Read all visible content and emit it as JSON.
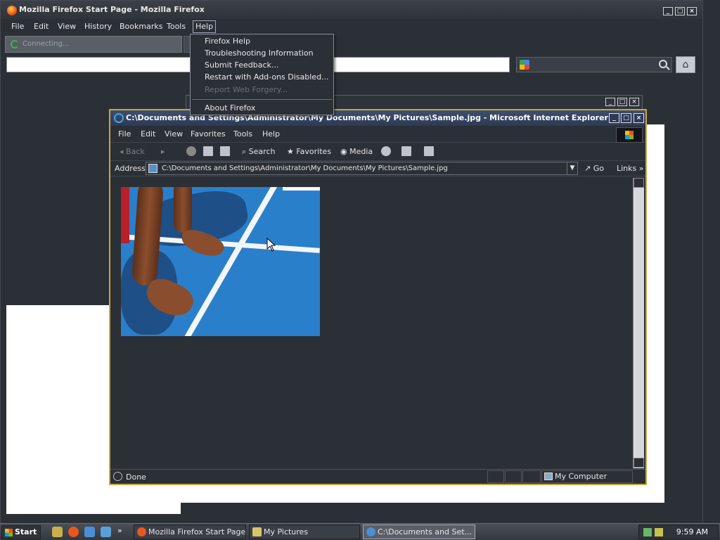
{
  "firefox": {
    "title": "Mozilla Firefox Start Page - Mozilla Firefox",
    "menu": [
      "File",
      "Edit",
      "View",
      "History",
      "Bookmarks",
      "Tools",
      "Help"
    ],
    "tab_label": "Connecting...",
    "help_menu": {
      "items": [
        "Firefox Help",
        "Troubleshooting Information",
        "Submit Feedback...",
        "Restart with Add-ons Disabled..."
      ],
      "disabled_item": "Report Web Forgery...",
      "about": "About Firefox"
    }
  },
  "ie": {
    "title": "C:\\Documents and Settings\\Administrator\\My Documents\\My Pictures\\Sample.jpg - Microsoft Internet Explorer",
    "menu": [
      "File",
      "Edit",
      "View",
      "Favorites",
      "Tools",
      "Help"
    ],
    "toolbar": {
      "back": "Back",
      "search": "Search",
      "favorites": "Favorites",
      "media": "Media"
    },
    "address_label": "Address",
    "address_value": "C:\\Documents and Settings\\Administrator\\My Documents\\My Pictures\\Sample.jpg",
    "go": "Go",
    "links": "Links",
    "status": "Done",
    "zone": "My Computer"
  },
  "taskbar": {
    "start": "Start",
    "tasks": [
      "Mozilla Firefox Start Page...",
      "My Pictures",
      "C:\\Documents and Set..."
    ],
    "clock": "9:59 AM"
  },
  "colors": {
    "ie_border": "#c8a73c",
    "court_blue": "#2a7fcb"
  }
}
